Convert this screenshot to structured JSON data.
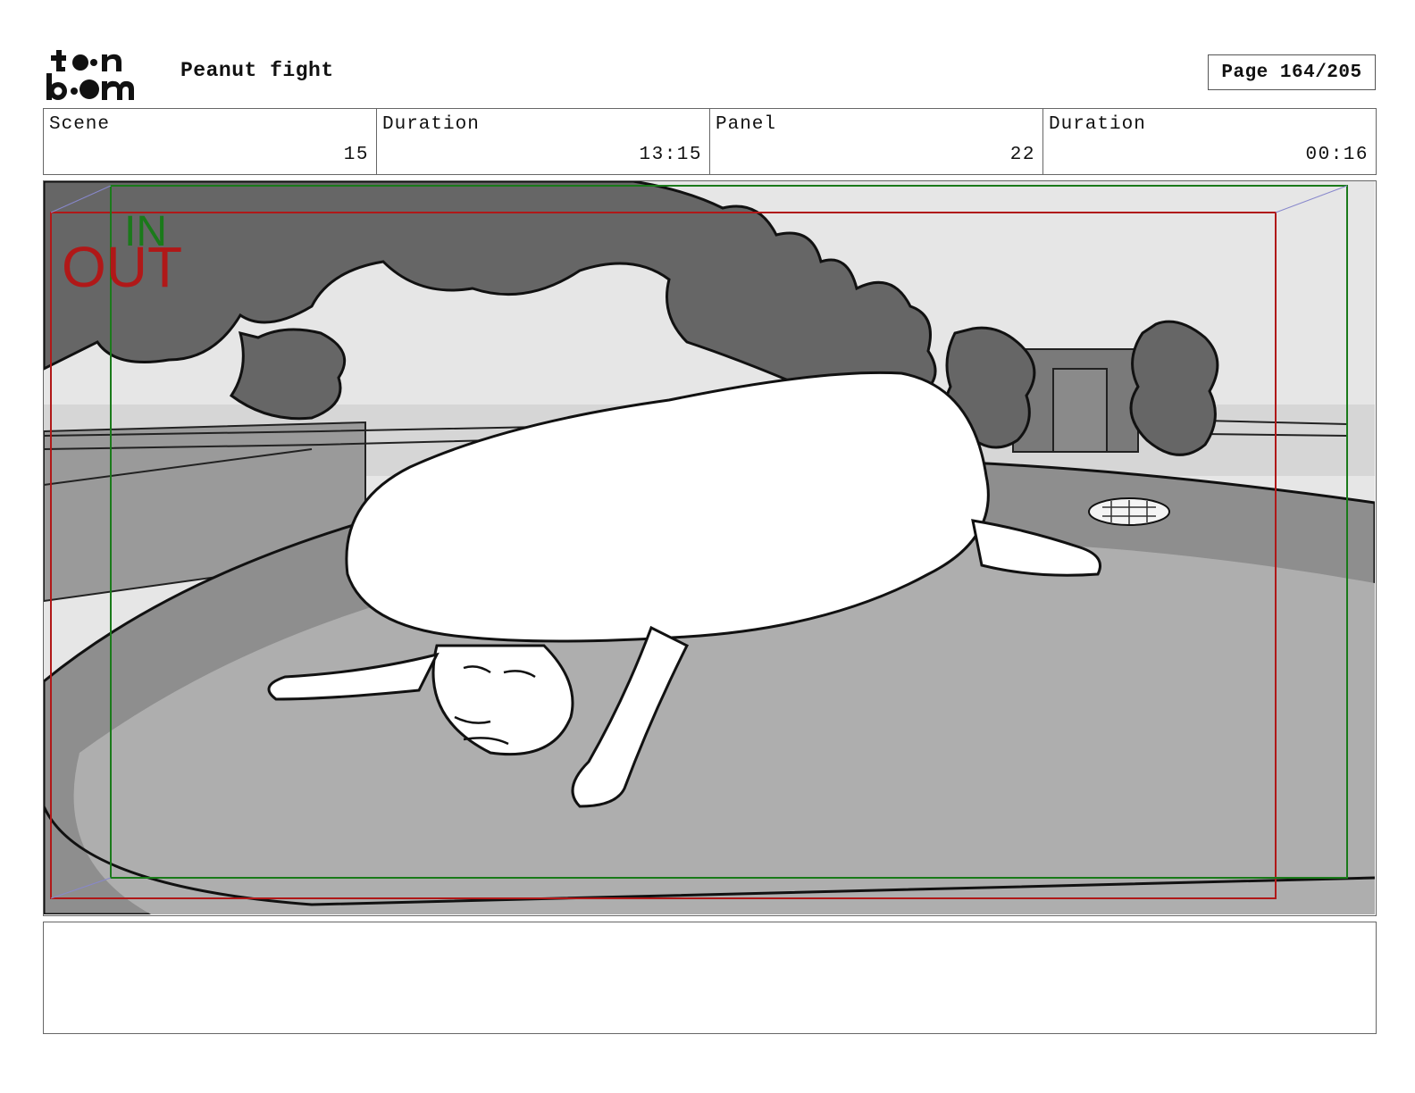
{
  "header": {
    "logo_alt": "toon boom",
    "title": "Peanut fight",
    "page_label": "Page 164/205"
  },
  "info": {
    "scene_label": "Scene",
    "scene_value": "15",
    "scene_duration_label": "Duration",
    "scene_duration_value": "13:15",
    "panel_label": "Panel",
    "panel_value": "22",
    "panel_duration_label": "Duration",
    "panel_duration_value": "00:16"
  },
  "panel": {
    "in_label": "IN",
    "out_label": "OUT",
    "in_frame_color": "#1a7a1a",
    "out_frame_color": "#b01818",
    "sky_color": "#e6e6e6",
    "tree_color": "#666666",
    "ground_color": "#aeaeae",
    "track_color": "#8e8e8e"
  },
  "notes": {
    "text": ""
  }
}
